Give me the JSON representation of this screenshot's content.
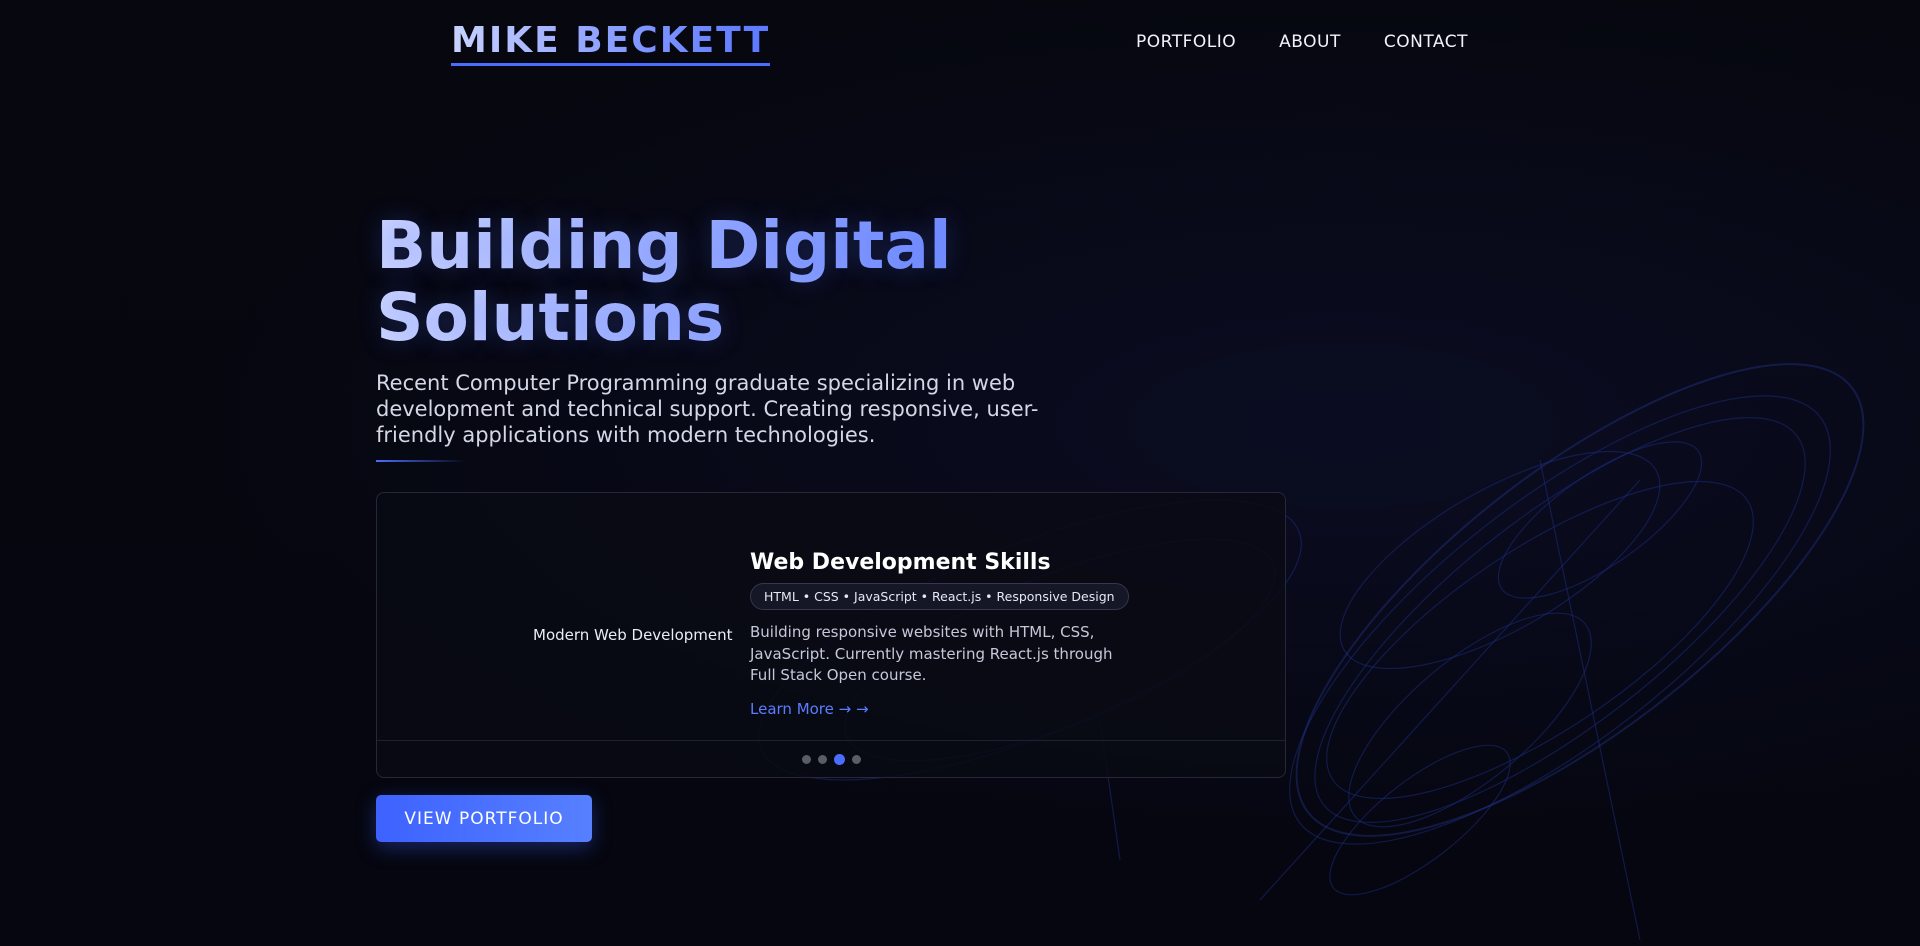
{
  "header": {
    "logo": "MIKE BECKETT",
    "nav": [
      {
        "label": "PORTFOLIO"
      },
      {
        "label": "ABOUT"
      },
      {
        "label": "CONTACT"
      }
    ]
  },
  "hero": {
    "title": "Building Digital Solutions",
    "subtitle": "Recent Computer Programming graduate specializing in web development and technical support. Creating responsive, user-friendly applications with modern technologies."
  },
  "card": {
    "image_label": "Modern Web Development",
    "title": "Web Development Skills",
    "tags": "HTML • CSS • JavaScript • React.js • Responsive Design",
    "description": "Building responsive websites with HTML, CSS, JavaScript. Currently mastering React.js through Full Stack Open course.",
    "link": "Learn More → →",
    "slides_total": 4,
    "active_slide": 3
  },
  "cta": {
    "label": "VIEW PORTFOLIO"
  },
  "colors": {
    "background": "#05060f",
    "accent": "#4a6cff",
    "link": "#5b7cff"
  }
}
